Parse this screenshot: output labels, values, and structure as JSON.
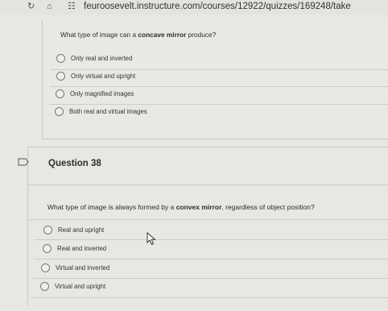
{
  "browser": {
    "url": "feuroosevelt.instructure.com/courses/12922/quizzes/169248/take"
  },
  "question_prev": {
    "prefix": "What type of image can a ",
    "emphasis": "concave mirror",
    "suffix": " produce?",
    "options": [
      "Only real and inverted",
      "Only virtual and upright",
      "Only magnified images",
      "Both real and virtual images"
    ]
  },
  "question_38": {
    "title": "Question 38",
    "prefix": "What type of image is always formed by a ",
    "emphasis": "convex mirror",
    "suffix": ", regardless of object position?",
    "options": [
      "Real and upright",
      "Real and inverted",
      "Virtual and inverted",
      "Virtual and upright"
    ]
  }
}
